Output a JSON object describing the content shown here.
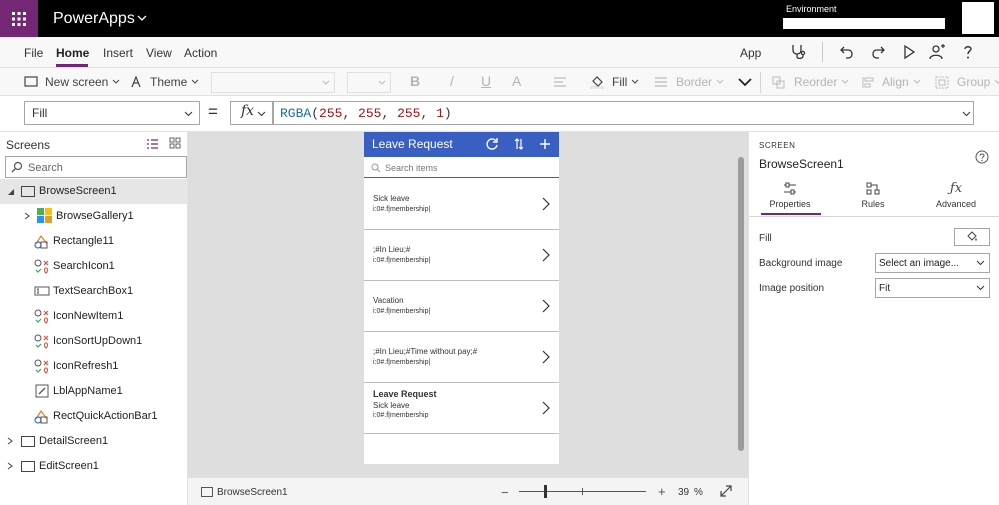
{
  "colors": {
    "brand": "#742774",
    "phone_header": "#3a5fc3",
    "canvas": "#dedede",
    "titlebar": "#000000"
  },
  "titlebar": {
    "app_name": "PowerApps",
    "environment_label": "Environment"
  },
  "menu": {
    "items": [
      "File",
      "Home",
      "Insert",
      "View",
      "Action"
    ],
    "active": "Home",
    "app_label": "App"
  },
  "ribbon": {
    "new_screen": "New screen",
    "theme": "Theme",
    "bold": "B",
    "italic": "/",
    "underline": "U",
    "font_color": "A",
    "fill": "Fill",
    "border": "Border",
    "reorder": "Reorder",
    "align": "Align",
    "group": "Group"
  },
  "formula": {
    "property": "Fill",
    "equals": "=",
    "fx": "fx",
    "fn": "RGBA",
    "open": "(",
    "args": [
      "255",
      "255",
      "255",
      "1"
    ],
    "sep": ", ",
    "close": ")"
  },
  "tree": {
    "title": "Screens",
    "search_placeholder": "Search",
    "items": [
      {
        "label": "BrowseScreen1",
        "icon": "screen-icon"
      },
      {
        "label": "BrowseGallery1",
        "icon": "gallery-icon"
      },
      {
        "label": "Rectangle11",
        "icon": "rectangle-icon"
      },
      {
        "label": "SearchIcon1",
        "icon": "icon-control-icon"
      },
      {
        "label": "TextSearchBox1",
        "icon": "text-input-icon"
      },
      {
        "label": "IconNewItem1",
        "icon": "icon-control-icon"
      },
      {
        "label": "IconSortUpDown1",
        "icon": "icon-control-icon"
      },
      {
        "label": "IconRefresh1",
        "icon": "icon-control-icon"
      },
      {
        "label": "LblAppName1",
        "icon": "label-icon"
      },
      {
        "label": "RectQuickActionBar1",
        "icon": "rectangle-icon"
      },
      {
        "label": "DetailScreen1",
        "icon": "screen-icon"
      },
      {
        "label": "EditScreen1",
        "icon": "screen-icon"
      }
    ]
  },
  "phone": {
    "title": "Leave Request",
    "search_placeholder": "Search items",
    "items": [
      {
        "title": "Sick leave",
        "subtitle": "i:0#.f|membership|"
      },
      {
        "title": ";#In Lieu;#",
        "subtitle": "i:0#.f|membership|"
      },
      {
        "title": "Vacation",
        "subtitle": "i:0#.f|membership|"
      },
      {
        "title": ";#In Lieu;#Time without pay;#",
        "subtitle": "i:0#.f|membership|"
      },
      {
        "title": "Leave Request",
        "subtitle": "Sick leave",
        "subtitle2": "i:0#.f|membership"
      }
    ]
  },
  "statusbar": {
    "screen_name": "BrowseScreen1",
    "zoom_minus": "−",
    "zoom_plus": "+",
    "zoom_value": "39",
    "zoom_unit": "%"
  },
  "properties": {
    "kind": "SCREEN",
    "name": "BrowseScreen1",
    "tabs": [
      "Properties",
      "Rules",
      "Advanced"
    ],
    "active_tab": "Properties",
    "fill_label": "Fill",
    "background_image_label": "Background image",
    "background_image_value": "Select an image...",
    "image_position_label": "Image position",
    "image_position_value": "Fit"
  }
}
